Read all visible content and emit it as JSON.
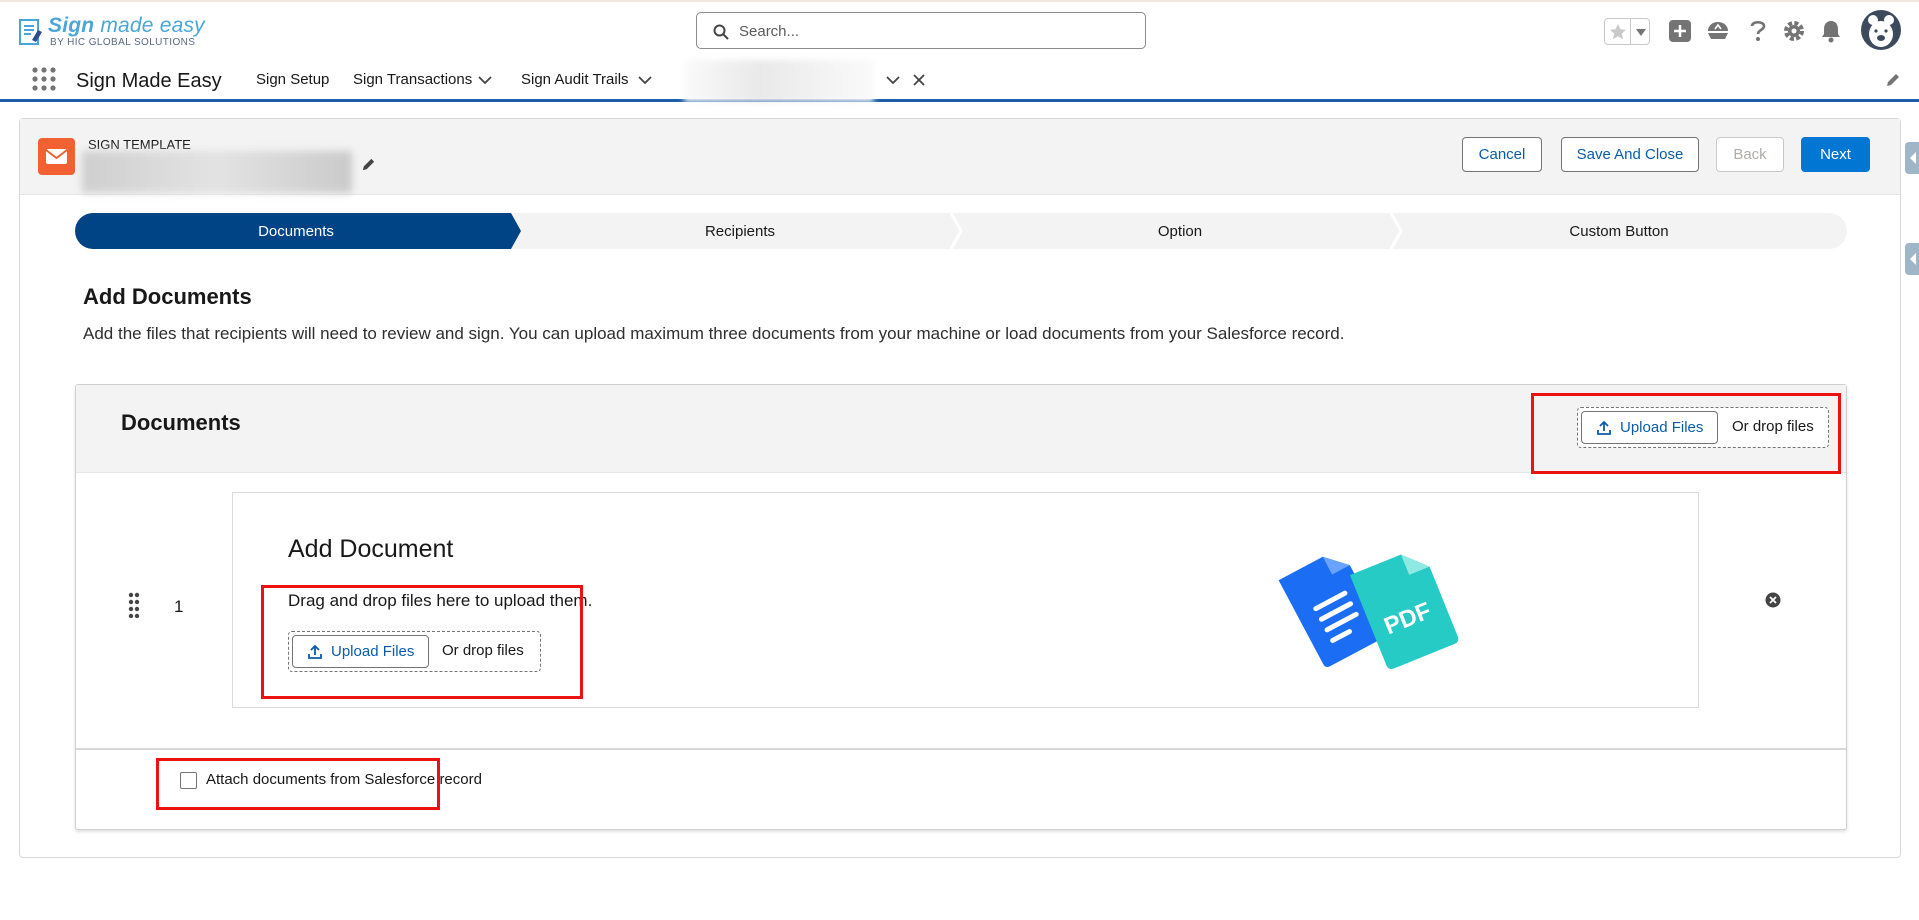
{
  "app": {
    "logo_main": "Sign",
    "logo_main2": "made easy",
    "logo_sub": "BY HIC GLOBAL SOLUTIONS",
    "name": "Sign Made Easy"
  },
  "search": {
    "placeholder": "Search..."
  },
  "nav": {
    "items": [
      {
        "label": "Sign Setup",
        "has_menu": false
      },
      {
        "label": "Sign Transactions",
        "has_menu": true
      },
      {
        "label": "Sign Audit Trails",
        "has_menu": true
      }
    ]
  },
  "template": {
    "type_label": "SIGN TEMPLATE"
  },
  "buttons": {
    "cancel": "Cancel",
    "save_close": "Save And Close",
    "back": "Back",
    "next": "Next"
  },
  "path": {
    "steps": [
      {
        "label": "Documents",
        "active": true
      },
      {
        "label": "Recipients",
        "active": false
      },
      {
        "label": "Option",
        "active": false
      },
      {
        "label": "Custom Button",
        "active": false
      }
    ]
  },
  "section": {
    "title": "Add Documents",
    "description": "Add the files that recipients will need to review and sign. You can upload maximum three documents from your machine or load documents from your Salesforce record."
  },
  "documents": {
    "title": "Documents",
    "upload_label": "Upload Files",
    "drop_label": "Or drop files",
    "rows": [
      {
        "index": "1",
        "title": "Add Document",
        "drag_text": "Drag and drop files here to upload them.",
        "upload_label": "Upload Files",
        "drop_label": "Or drop files",
        "badge": "PDF"
      }
    ],
    "attach_label": "Attach documents from Salesforce record",
    "attach_checked": false
  },
  "colors": {
    "brand": "#0176d3",
    "path_active": "#014486",
    "template_icon": "#f26132",
    "highlight": "#ee1111"
  }
}
